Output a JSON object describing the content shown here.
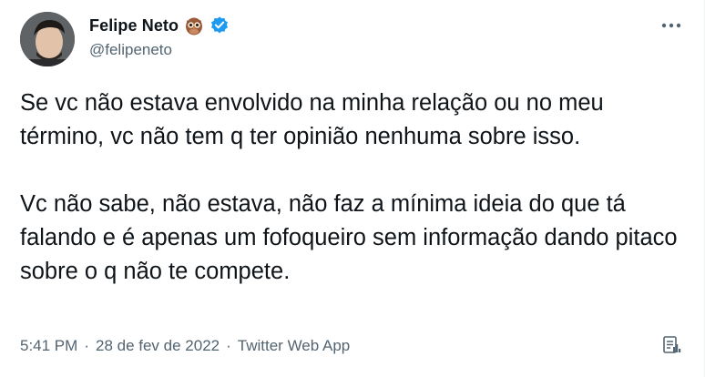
{
  "author": {
    "display_name": "Felipe Neto",
    "handle": "@felipeneto",
    "emoji_icon": "owl-emoji",
    "verified_icon": "verified-badge-icon",
    "verified_color": "#1d9bf0"
  },
  "tweet": {
    "paragraphs": [
      "Se vc não estava envolvido na minha relação ou no meu término, vc não tem q ter opinião nenhuma sobre isso.",
      "Vc não sabe, não estava, não faz a mínima ideia do que tá falando e é apenas um fofoqueiro sem informação dando pitaco sobre o q não te compete."
    ]
  },
  "meta": {
    "time": "5:41 PM",
    "separator": "·",
    "date": "28 de fev de 2022",
    "source": "Twitter Web App"
  },
  "icons": {
    "more": "more-options-icon",
    "analytics": "analytics-icon"
  }
}
